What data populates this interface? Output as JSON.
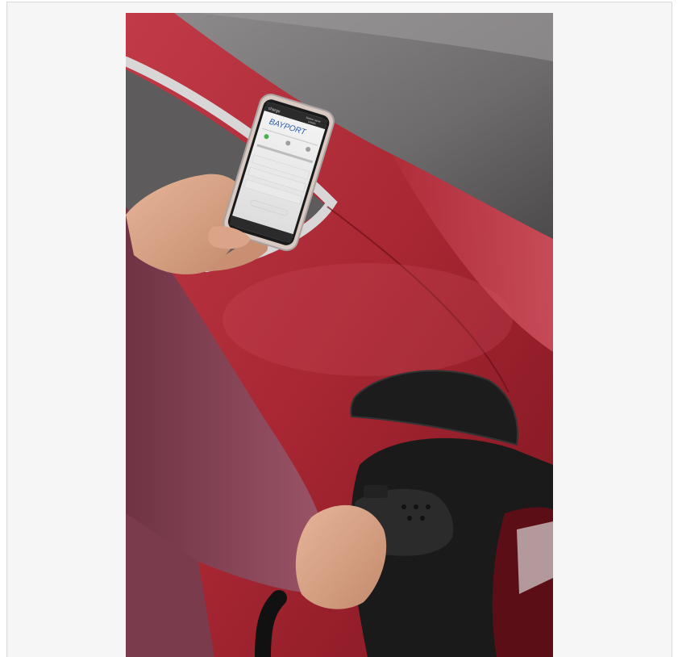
{
  "photo": {
    "alt": "Person checking a charging app on a phone while plugging a charger into a red electric car",
    "phone_screen": {
      "brand_small": "charge",
      "logo_text": "BAYPORT",
      "top_right_line1": "Station name",
      "top_right_line2": "Details"
    }
  },
  "colors": {
    "frame_bg": "#f6f6f6",
    "car_red": "#b3303d",
    "sleeve": "#8a4657",
    "skin": "#d9a487",
    "charger": "#2b2b2b"
  }
}
